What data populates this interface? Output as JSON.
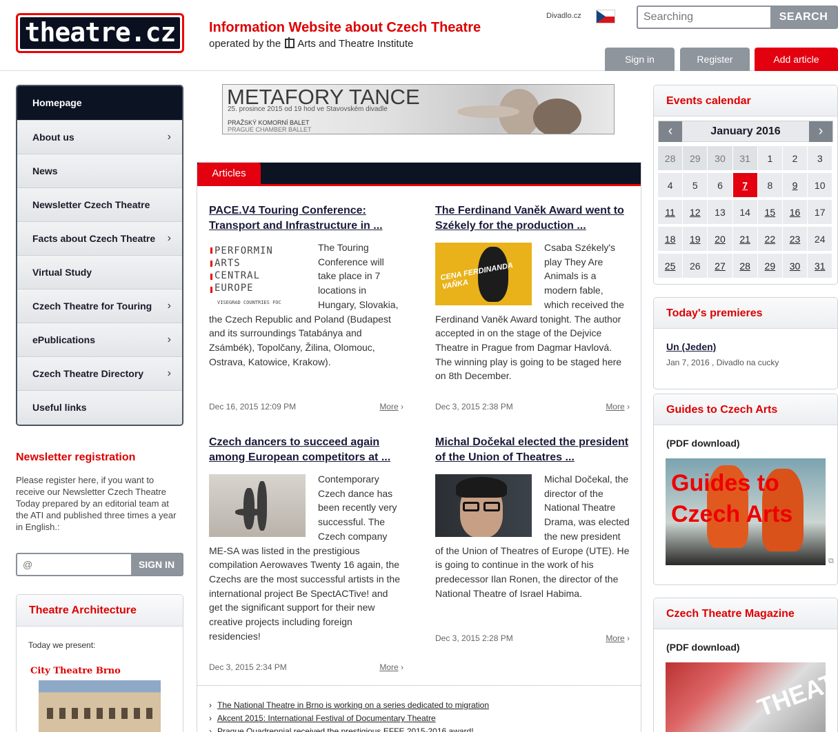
{
  "header": {
    "logo": "theatre.cz",
    "tagline_title": "Information Website about Czech Theatre",
    "tagline_sub_prefix": "operated by the",
    "tagline_sub_org": "Arts and Theatre Institute",
    "lang_link": "Divadlo.cz",
    "search_placeholder": "Searching",
    "search_button": "SEARCH",
    "sign_in": "Sign in",
    "register": "Register",
    "add_article": "Add article"
  },
  "nav": {
    "items": [
      {
        "label": "Homepage",
        "chevron": ""
      },
      {
        "label": "About us",
        "chevron": "›"
      },
      {
        "label": "News",
        "chevron": ""
      },
      {
        "label": "Newsletter Czech Theatre",
        "chevron": ""
      },
      {
        "label": "Facts about Czech Theatre",
        "chevron": "›"
      },
      {
        "label": "Virtual Study",
        "chevron": ""
      },
      {
        "label": "Czech Theatre for Touring",
        "chevron": "›"
      },
      {
        "label": "ePublications",
        "chevron": "›"
      },
      {
        "label": "Czech Theatre Directory",
        "chevron": "›"
      },
      {
        "label": "Useful links",
        "chevron": ""
      }
    ]
  },
  "newsletter": {
    "title": "Newsletter registration",
    "text": "Please register here, if you want to receive our Newsletter Czech Theatre Today prepared by an editorial team at the ATI and published three times a year in English.:",
    "input_placeholder": "@",
    "button": "SIGN IN"
  },
  "architecture": {
    "title": "Theatre Architecture",
    "present": "Today we present:",
    "theatre": "City Theatre Brno"
  },
  "banner": {
    "title": "METAFORY TANCE",
    "subtitle": "25. prosince 2015 od 19 hod ve Stavovském divadle",
    "org1": "PRAŽSKÝ KOMORNÍ BALET",
    "org2": "PRAGUE CHAMBER BALLET"
  },
  "articles": {
    "tab": "Articles",
    "items": [
      {
        "title": "PACE.V4 Touring Conference: Transport and Infrastructure in ...",
        "body": "The Touring Conference will take place in 7 locations in Hungary, Slovakia, the Czech Republic and Poland (Budapest and its surroundings Tatabánya and Zsámbék), Topolčany, Žilina, Olomouc, Ostrava, Katowice, Krakow).",
        "date": "Dec 16, 2015 12:09 PM",
        "more": "More"
      },
      {
        "title": "The Ferdinand Vaněk Award went to Székely for the production ...",
        "body": "Csaba Székely's play They Are Animals is a modern fable, which received the Ferdinand Vaněk Award tonight. The author accepted in on the stage of the Dejvice Theatre in Prague from Dagmar Havlová. The winning play is going to be staged here on 8th December.",
        "date": "Dec 3, 2015 2:38 PM",
        "more": "More"
      },
      {
        "title": "Czech dancers to succeed again among European competitors at ...",
        "body": "Contemporary Czech dance has been recently very successful. The Czech company ME-SA was listed in the prestigious compilation Aerowaves Twenty 16 again, the Czechs are the most successful artists in the international project Be SpectACTive! and get the significant support for their new creative projects including foreign residencies!",
        "date": "Dec 3, 2015 2:34 PM",
        "more": "More"
      },
      {
        "title": "Michal Dočekal elected the president of the Union of Theatres ...",
        "body": "Michal Dočekal, the director of the National Theatre Drama, was elected the new president of the Union of Theatres of Europe (UTE). He is going to continue in the work of his predecessor Ilan Ronen, the director of the National Theatre of Israel Habima.",
        "date": "Dec 3, 2015 2:28 PM",
        "more": "More"
      }
    ],
    "pace_logo": {
      "lines": [
        "PERFORMIN",
        "ARTS",
        "CENTRAL",
        "EUROPE"
      ],
      "sub": "VISEGRAD COUNTRIES FOC"
    },
    "vanek_logo": "CENA FERDINANDA VAŇKA",
    "links": [
      "The National Theatre in Brno is working on a series dedicated to migration",
      "Akcent 2015: International Festival of Documentary Theatre",
      "Prague Quadrennial received the prestigious EFFE 2015-2016 award!"
    ]
  },
  "calendar": {
    "title": "Events calendar",
    "month": "January 2016",
    "prev": "‹",
    "next": "›",
    "weeks": [
      [
        {
          "d": "28",
          "c": "other"
        },
        {
          "d": "29",
          "c": "other"
        },
        {
          "d": "30",
          "c": "other"
        },
        {
          "d": "31",
          "c": "other"
        },
        {
          "d": "1",
          "c": ""
        },
        {
          "d": "2",
          "c": ""
        },
        {
          "d": "3",
          "c": ""
        }
      ],
      [
        {
          "d": "4",
          "c": ""
        },
        {
          "d": "5",
          "c": ""
        },
        {
          "d": "6",
          "c": ""
        },
        {
          "d": "7",
          "c": "today"
        },
        {
          "d": "8",
          "c": ""
        },
        {
          "d": "9",
          "c": "ev"
        },
        {
          "d": "10",
          "c": ""
        }
      ],
      [
        {
          "d": "11",
          "c": "ev"
        },
        {
          "d": "12",
          "c": "ev"
        },
        {
          "d": "13",
          "c": ""
        },
        {
          "d": "14",
          "c": ""
        },
        {
          "d": "15",
          "c": "ev"
        },
        {
          "d": "16",
          "c": "ev"
        },
        {
          "d": "17",
          "c": ""
        }
      ],
      [
        {
          "d": "18",
          "c": "ev"
        },
        {
          "d": "19",
          "c": "ev"
        },
        {
          "d": "20",
          "c": "ev"
        },
        {
          "d": "21",
          "c": "ev"
        },
        {
          "d": "22",
          "c": "ev"
        },
        {
          "d": "23",
          "c": "ev"
        },
        {
          "d": "24",
          "c": ""
        }
      ],
      [
        {
          "d": "25",
          "c": "ev"
        },
        {
          "d": "26",
          "c": ""
        },
        {
          "d": "27",
          "c": "ev"
        },
        {
          "d": "28",
          "c": "ev"
        },
        {
          "d": "29",
          "c": "ev"
        },
        {
          "d": "30",
          "c": "ev"
        },
        {
          "d": "31",
          "c": "ev"
        }
      ]
    ]
  },
  "premieres": {
    "title": "Today's premieres",
    "item_title": "Un (Jeden)",
    "item_info": "Jan 7, 2016 , Divadlo na cucky"
  },
  "guides": {
    "title": "Guides to Czech Arts",
    "pdf": "(PDF download)",
    "image_text": "Guides to Czech Arts"
  },
  "magazine": {
    "title": "Czech Theatre Magazine",
    "pdf": "(PDF download)",
    "image_text": "THEATRE"
  },
  "colors": {
    "accent_red": "#e3000f",
    "nav_dark": "#0c1424",
    "button_grey": "#8e949c"
  }
}
